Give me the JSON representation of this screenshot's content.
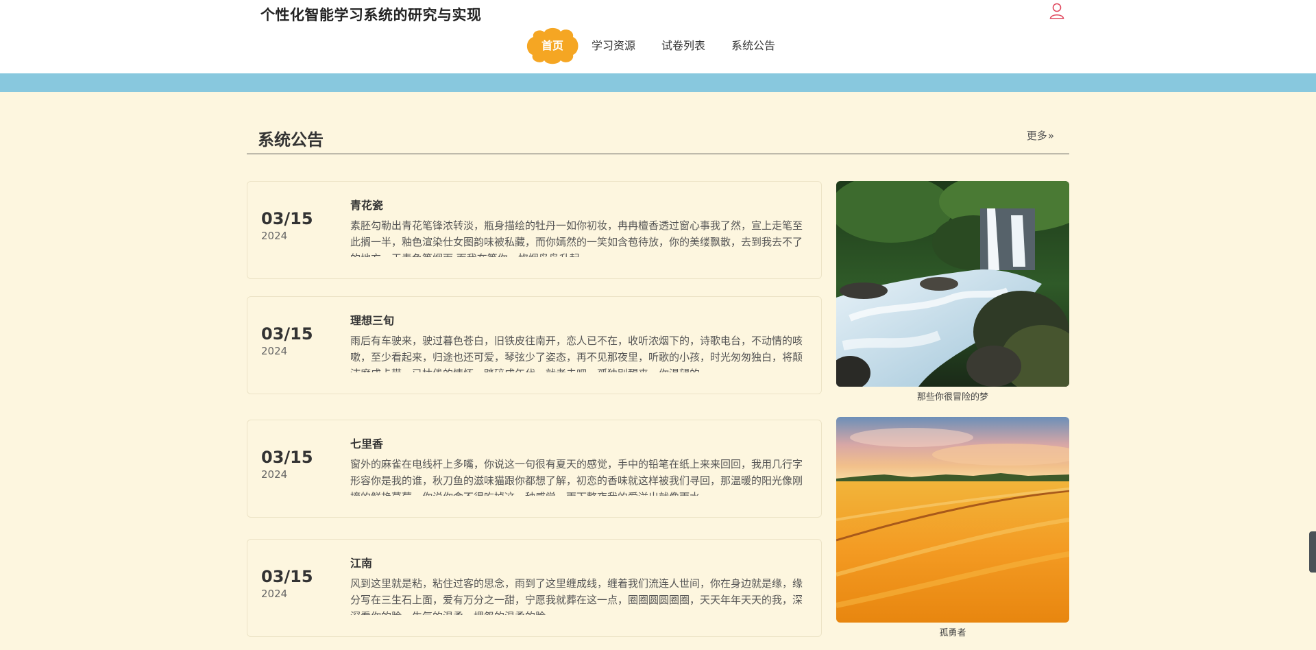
{
  "header": {
    "title": "个性化智能学习系统的研究与实现",
    "nav": [
      {
        "label": "首页",
        "active": true
      },
      {
        "label": "学习资源",
        "active": false
      },
      {
        "label": "试卷列表",
        "active": false
      },
      {
        "label": "系统公告",
        "active": false
      }
    ],
    "user_icon": "user-icon",
    "accent": "#f5a623"
  },
  "section": {
    "title": "系统公告",
    "more_label": "更多"
  },
  "notices": [
    {
      "date": "03/15",
      "year": "2024",
      "title": "青花瓷",
      "text": "素胚勾勒出青花笔锋浓转淡，瓶身描绘的牡丹一如你初妆，冉冉檀香透过窗心事我了然，宣上走笔至此搁一半，釉色渲染仕女图韵味被私藏，而你嫣然的一笑如含苞待放，你的美缕飘散，去到我去不了的地方，天青色等烟雨 而我在等你，炊烟袅袅升起"
    },
    {
      "date": "03/15",
      "year": "2024",
      "title": "理想三旬",
      "text": "雨后有车驶来，驶过暮色苍白，旧铁皮往南开，恋人已不在，收听浓烟下的，诗歌电台，不动情的咳嗽，至少看起来，归途也还可爱，琴弦少了姿态，再不见那夜里，听歌的小孩，时光匆匆独白，将颠沛磨成卡带，已枯倦的情怀，踏碎成年代，就老去吧，孤独别醒来，你渴望的"
    },
    {
      "date": "03/15",
      "year": "2024",
      "title": "七里香",
      "text": "窗外的麻雀在电线杆上多嘴，你说这一句很有夏天的感觉，手中的铅笔在纸上来来回回，我用几行字形容你是我的谁，秋刀鱼的滋味猫跟你都想了解，初恋的香味就这样被我们寻回，那温暖的阳光像刚摘的鲜艳草莓，你说你舍不得吃掉这一种感觉，雨下整夜我的爱溢出就像雨水"
    },
    {
      "date": "03/15",
      "year": "2024",
      "title": "江南",
      "text": "风到这里就是粘，粘住过客的思念，雨到了这里缠成线，缠着我们流连人世间，你在身边就是缘，缘分写在三生石上面，爱有万分之一甜，宁愿我就葬在这一点，圈圈圆圆圈圈，天天年年天天的我，深深看你的脸，生气的温柔，埋怨的温柔的脸"
    }
  ],
  "pictures": [
    {
      "caption": "那些你很冒险的梦",
      "scene": "waterfall"
    },
    {
      "caption": "孤勇者",
      "scene": "wheat-field"
    }
  ]
}
